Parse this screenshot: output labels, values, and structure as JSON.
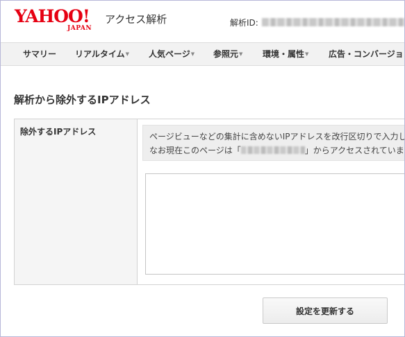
{
  "header": {
    "logo_text": "YAHOO!",
    "logo_sub": "JAPAN",
    "app_title": "アクセス解析",
    "id_label": "解析ID:"
  },
  "nav": {
    "items": [
      {
        "label": "サマリー",
        "has_dropdown": false
      },
      {
        "label": "リアルタイム",
        "has_dropdown": true
      },
      {
        "label": "人気ページ",
        "has_dropdown": true
      },
      {
        "label": "参照元",
        "has_dropdown": true
      },
      {
        "label": "環境・属性",
        "has_dropdown": true
      },
      {
        "label": "広告・コンバージョン",
        "has_dropdown": false
      }
    ],
    "caret_glyph": "▼"
  },
  "page": {
    "title": "解析から除外するIPアドレス"
  },
  "form": {
    "field_label": "除外するIPアドレス",
    "notice_line1": "ページビューなどの集計に含めないIPアドレスを改行区切りで入力して",
    "notice_line2_prefix": "なお現在このページは「",
    "notice_line2_suffix": "」からアクセスされています",
    "textarea_value": "",
    "submit_label": "設定を更新する"
  },
  "colors": {
    "brand_red": "#e60012",
    "nav_bg": "#f2f2f2",
    "notice_bg": "#eeeeee"
  }
}
